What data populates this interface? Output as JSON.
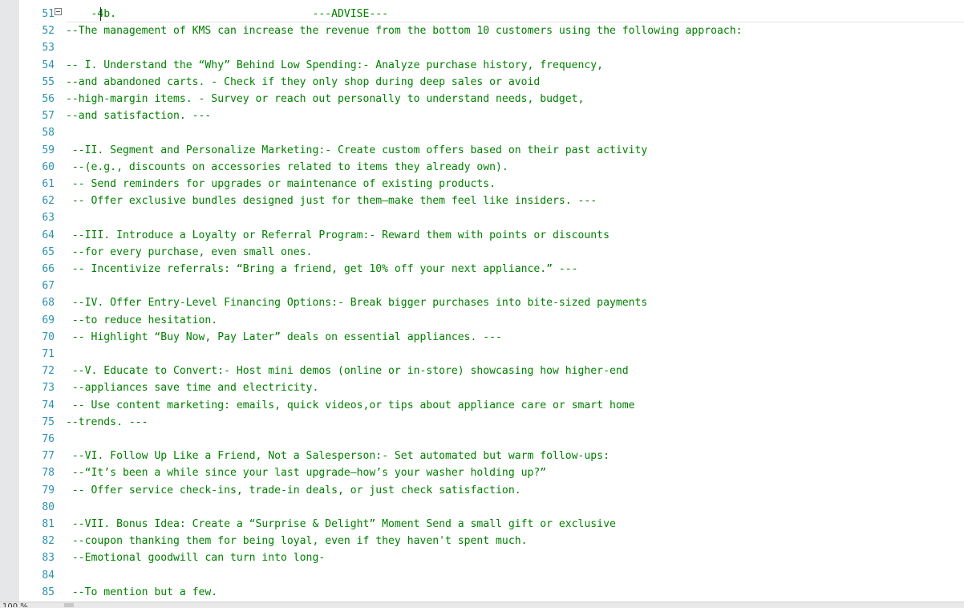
{
  "editor": {
    "zoom_level": "100 %",
    "lines": [
      {
        "number": "51",
        "text": "    -4b.                               ---ADVISE---"
      },
      {
        "number": "52",
        "text": "--The management of KMS can increase the revenue from the bottom 10 customers using the following approach:"
      },
      {
        "number": "53",
        "text": ""
      },
      {
        "number": "54",
        "text": "-- I. Understand the “Why” Behind Low Spending:- Analyze purchase history, frequency,"
      },
      {
        "number": "55",
        "text": "--and abandoned carts. - Check if they only shop during deep sales or avoid"
      },
      {
        "number": "56",
        "text": "--high-margin items. - Survey or reach out personally to understand needs, budget,"
      },
      {
        "number": "57",
        "text": "--and satisfaction. ---"
      },
      {
        "number": "58",
        "text": ""
      },
      {
        "number": "59",
        "text": " --II. Segment and Personalize Marketing:- Create custom offers based on their past activity"
      },
      {
        "number": "60",
        "text": " --(e.g., discounts on accessories related to items they already own)."
      },
      {
        "number": "61",
        "text": " -- Send reminders for upgrades or maintenance of existing products."
      },
      {
        "number": "62",
        "text": " -- Offer exclusive bundles designed just for them—make them feel like insiders. ---"
      },
      {
        "number": "63",
        "text": ""
      },
      {
        "number": "64",
        "text": " --III. Introduce a Loyalty or Referral Program:- Reward them with points or discounts"
      },
      {
        "number": "65",
        "text": " --for every purchase, even small ones."
      },
      {
        "number": "66",
        "text": " -- Incentivize referrals: “Bring a friend, get 10% off your next appliance.” ---"
      },
      {
        "number": "67",
        "text": ""
      },
      {
        "number": "68",
        "text": " --IV. Offer Entry-Level Financing Options:- Break bigger purchases into bite-sized payments"
      },
      {
        "number": "69",
        "text": " --to reduce hesitation."
      },
      {
        "number": "70",
        "text": " -- Highlight “Buy Now, Pay Later” deals on essential appliances. ---"
      },
      {
        "number": "71",
        "text": ""
      },
      {
        "number": "72",
        "text": " --V. Educate to Convert:- Host mini demos (online or in-store) showcasing how higher-end"
      },
      {
        "number": "73",
        "text": " --appliances save time and electricity."
      },
      {
        "number": "74",
        "text": " -- Use content marketing: emails, quick videos,or tips about appliance care or smart home"
      },
      {
        "number": "75",
        "text": "--trends. ---"
      },
      {
        "number": "76",
        "text": ""
      },
      {
        "number": "77",
        "text": " --VI. Follow Up Like a Friend, Not a Salesperson:- Set automated but warm follow-ups:"
      },
      {
        "number": "78",
        "text": " --“It’s been a while since your last upgrade—how’s your washer holding up?”"
      },
      {
        "number": "79",
        "text": " -- Offer service check-ins, trade-in deals, or just check satisfaction."
      },
      {
        "number": "80",
        "text": ""
      },
      {
        "number": "81",
        "text": " --VII. Bonus Idea: Create a “Surprise & Delight” Moment Send a small gift or exclusive"
      },
      {
        "number": "82",
        "text": " --coupon thanking them for being loyal, even if they haven't spent much."
      },
      {
        "number": "83",
        "text": " --Emotional goodwill can turn into long-"
      },
      {
        "number": "84",
        "text": ""
      },
      {
        "number": "85",
        "text": " --To mention but a few."
      }
    ]
  }
}
